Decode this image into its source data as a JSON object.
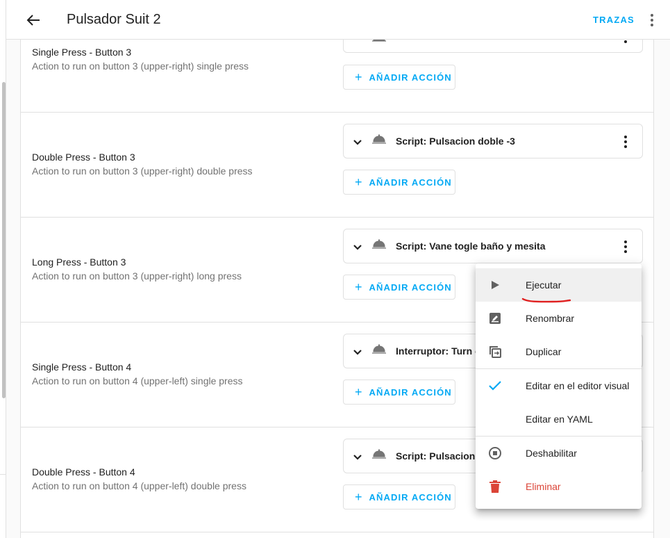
{
  "header": {
    "title": "Pulsador Suit 2",
    "traces_label": "TRAZAS"
  },
  "rows": [
    {
      "title": "Single Press - Button 3",
      "description": "Action to run on button 3 (upper-right) single press",
      "add_label": "AÑADIR ACCIÓN"
    },
    {
      "title": "Double Press - Button 3",
      "description": "Action to run on button 3 (upper-right) double press",
      "action": "Script: Pulsacion doble -3",
      "add_label": "AÑADIR ACCIÓN"
    },
    {
      "title": "Long Press - Button 3",
      "description": "Action to run on button 3 (upper-right) long press",
      "action": "Script: Vane togle baño y mesita",
      "add_label": "AÑADIR ACCIÓN"
    },
    {
      "title": "Single Press - Button 4",
      "description": "Action to run on button 4 (upper-left) single press",
      "action": "Interruptor: Turn on",
      "add_label": "AÑADIR ACCIÓN"
    },
    {
      "title": "Double Press - Button 4",
      "description": "Action to run on button 4 (upper-left) double press",
      "action": "Script: Pulsacion d",
      "add_label": "AÑADIR ACCIÓN"
    }
  ],
  "menu": {
    "items": [
      {
        "label": "Ejecutar",
        "icon": "play-icon"
      },
      {
        "label": "Renombrar",
        "icon": "rename-icon"
      },
      {
        "label": "Duplicar",
        "icon": "duplicate-icon"
      },
      {
        "label": "Editar en el editor visual",
        "icon": "check-icon"
      },
      {
        "label": "Editar en YAML",
        "icon": ""
      },
      {
        "label": "Deshabilitar",
        "icon": "disable-icon"
      },
      {
        "label": "Eliminar",
        "icon": "delete-icon"
      }
    ]
  },
  "colors": {
    "accent": "#03a9f4",
    "danger": "#db4437",
    "annotation": "#e02020"
  }
}
